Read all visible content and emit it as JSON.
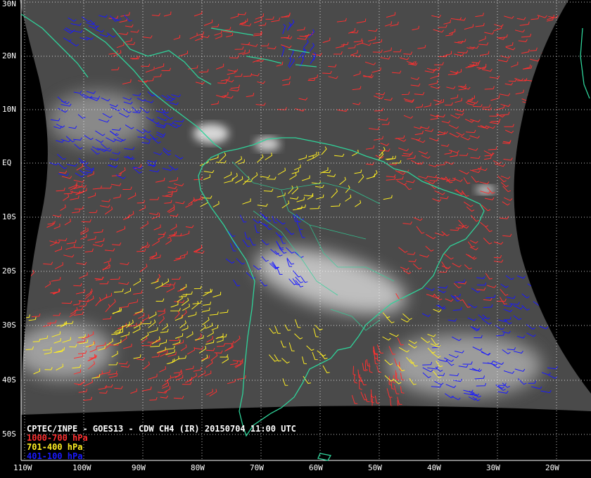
{
  "map": {
    "latitude_labels": [
      "30N",
      "20N",
      "10N",
      "EQ",
      "10S",
      "20S",
      "30S",
      "40S",
      "50S"
    ],
    "longitude_labels": [
      "110W",
      "100W",
      "90W",
      "80W",
      "70W",
      "60W",
      "50W",
      "40W",
      "30W",
      "20W"
    ],
    "extent": {
      "lon_range": [
        -110,
        -20
      ],
      "lat_range": [
        -55,
        30
      ]
    },
    "grid": "dotted",
    "colors": {
      "background": "#000000",
      "satellite_disk": "#4a4a4a",
      "coastline": "#2fd39a",
      "grid": "#ffffff",
      "low_level_vectors": "#ff3030",
      "mid_level_vectors": "#ffee22",
      "high_level_vectors": "#1a1aff"
    }
  },
  "caption": {
    "title": "CPTEC/INPE - GOES13 - CDW CH4 (IR) 20150704 11:00 UTC",
    "legend": [
      {
        "label": "1000-700 hPa",
        "color": "#ff3030"
      },
      {
        "label": "701-400 hPa",
        "color": "#ffee22"
      },
      {
        "label": "401-100 hPa",
        "color": "#1a1aff"
      }
    ]
  }
}
